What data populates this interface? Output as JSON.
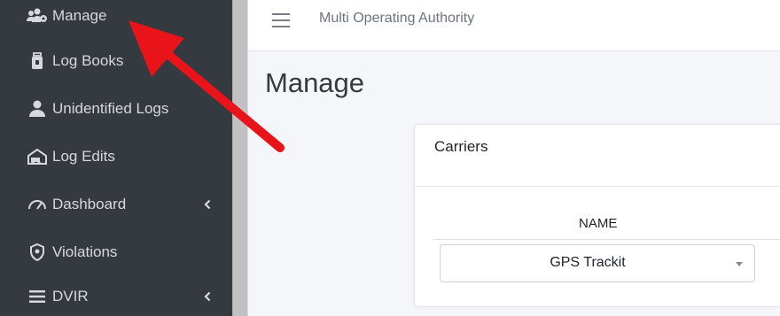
{
  "sidebar": {
    "items": [
      {
        "label": "Manage",
        "icon": "users-cog-icon"
      },
      {
        "label": "Log Books",
        "icon": "book-lock-icon"
      },
      {
        "label": "Unidentified Logs",
        "icon": "user-icon"
      },
      {
        "label": "Log Edits",
        "icon": "truck-edit-icon"
      },
      {
        "label": "Dashboard",
        "icon": "gauge-icon",
        "has_submenu": true
      },
      {
        "label": "Violations",
        "icon": "shield-icon"
      },
      {
        "label": "DVIR",
        "icon": "list-icon",
        "has_submenu": true
      }
    ]
  },
  "header": {
    "menu_icon": "hamburger-icon",
    "title": "Multi Operating Authority"
  },
  "main": {
    "page_title": "Manage",
    "card": {
      "title": "Carriers",
      "column_header": "NAME",
      "carrier_select": {
        "value": "GPS Trackit"
      }
    }
  },
  "colors": {
    "sidebar_bg": "#343a40",
    "sidebar_text": "#d6d8db",
    "annotation_arrow": "#e8141a"
  }
}
